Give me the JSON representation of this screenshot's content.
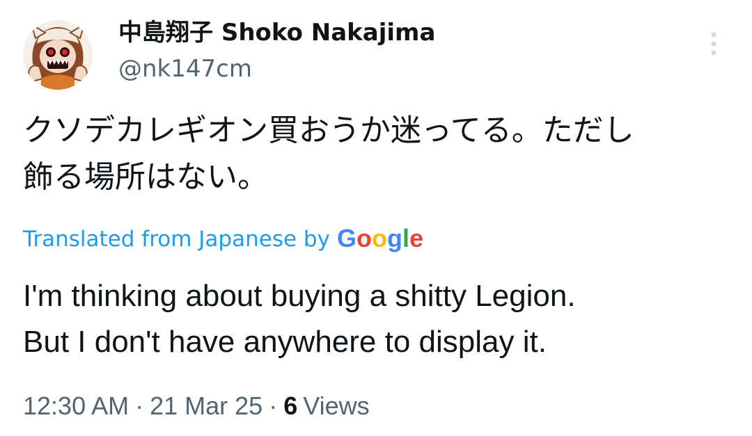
{
  "author": {
    "display_name": "中島翔子 Shoko Nakajima",
    "handle": "@nk147cm"
  },
  "tweet": {
    "text": "クソデカレギオン買おうか迷ってる。ただし\n飾る場所はない。",
    "translation_label": "Translated from Japanese by",
    "translation_provider": "Google",
    "translated_text": "I'm thinking about buying a shitty Legion.\nBut I don't have anywhere to display it."
  },
  "meta": {
    "time": "12:30 AM",
    "separator": "·",
    "date": "21 Mar 25",
    "views_count": "6",
    "views_label": "Views"
  },
  "icons": {
    "more": "more-vertical-icon",
    "avatar": "avatar-image"
  },
  "colors": {
    "link": "#1d9bf0",
    "secondary_text": "#536471",
    "primary_text": "#0f1419",
    "more_icon": "#cfd9de",
    "google_blue": "#4285F4",
    "google_red": "#EA4335",
    "google_yellow": "#FBBC05",
    "google_green": "#34A853"
  }
}
